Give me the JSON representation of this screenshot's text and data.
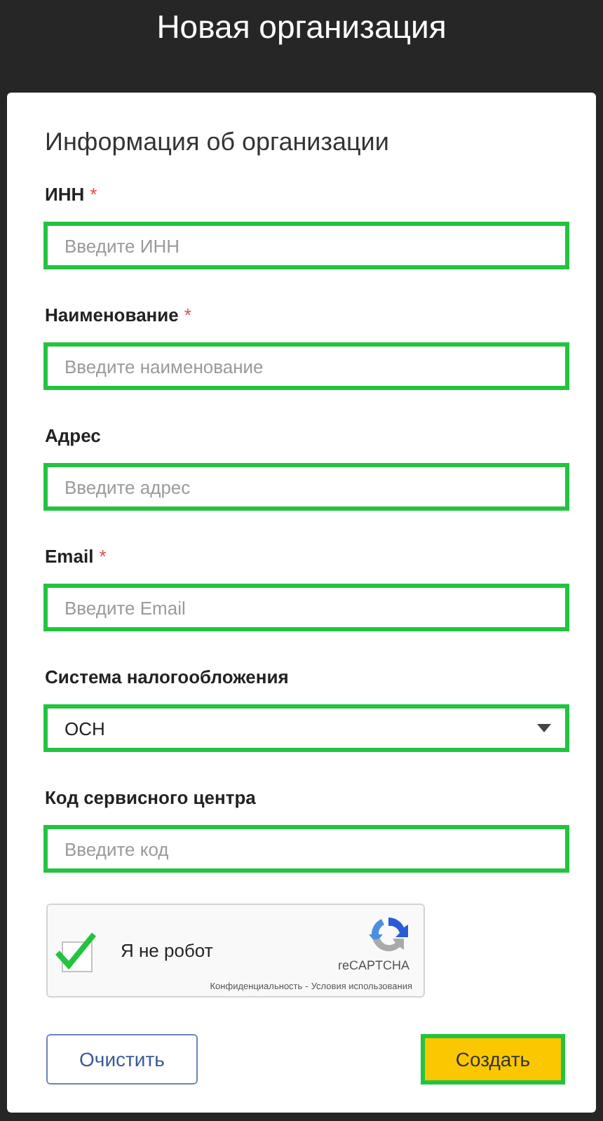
{
  "page_title": "Новая организация",
  "form": {
    "heading": "Информация об организации",
    "fields": [
      {
        "kind": "input",
        "label": "ИНН",
        "required_mark": "*",
        "placeholder": "Введите ИНН",
        "highlighted": true
      },
      {
        "kind": "input",
        "label": "Наименование",
        "required_mark": "*",
        "placeholder": "Введите наименование",
        "highlighted": true
      },
      {
        "kind": "input",
        "label": "Адрес",
        "placeholder": "Введите адрес",
        "highlighted": true
      },
      {
        "kind": "input",
        "label": "Email",
        "required_mark": "*",
        "placeholder": "Введите Email",
        "highlighted": true
      },
      {
        "kind": "select",
        "label": "Система налогообложения",
        "value": "ОСН",
        "highlighted": true
      },
      {
        "kind": "input",
        "label": "Код сервисного центра",
        "placeholder": "Введите код",
        "highlighted": true
      }
    ],
    "captcha": {
      "label": "Я не робот",
      "checked": true,
      "brand": "reCAPTCHA",
      "privacy": "Конфиденциальность",
      "separator": "-",
      "terms": "Условия использования"
    },
    "buttons": [
      {
        "kind": "secondary",
        "label": "Очистить",
        "highlighted": false
      },
      {
        "kind": "primary",
        "label": "Создать",
        "highlighted": true
      }
    ]
  }
}
